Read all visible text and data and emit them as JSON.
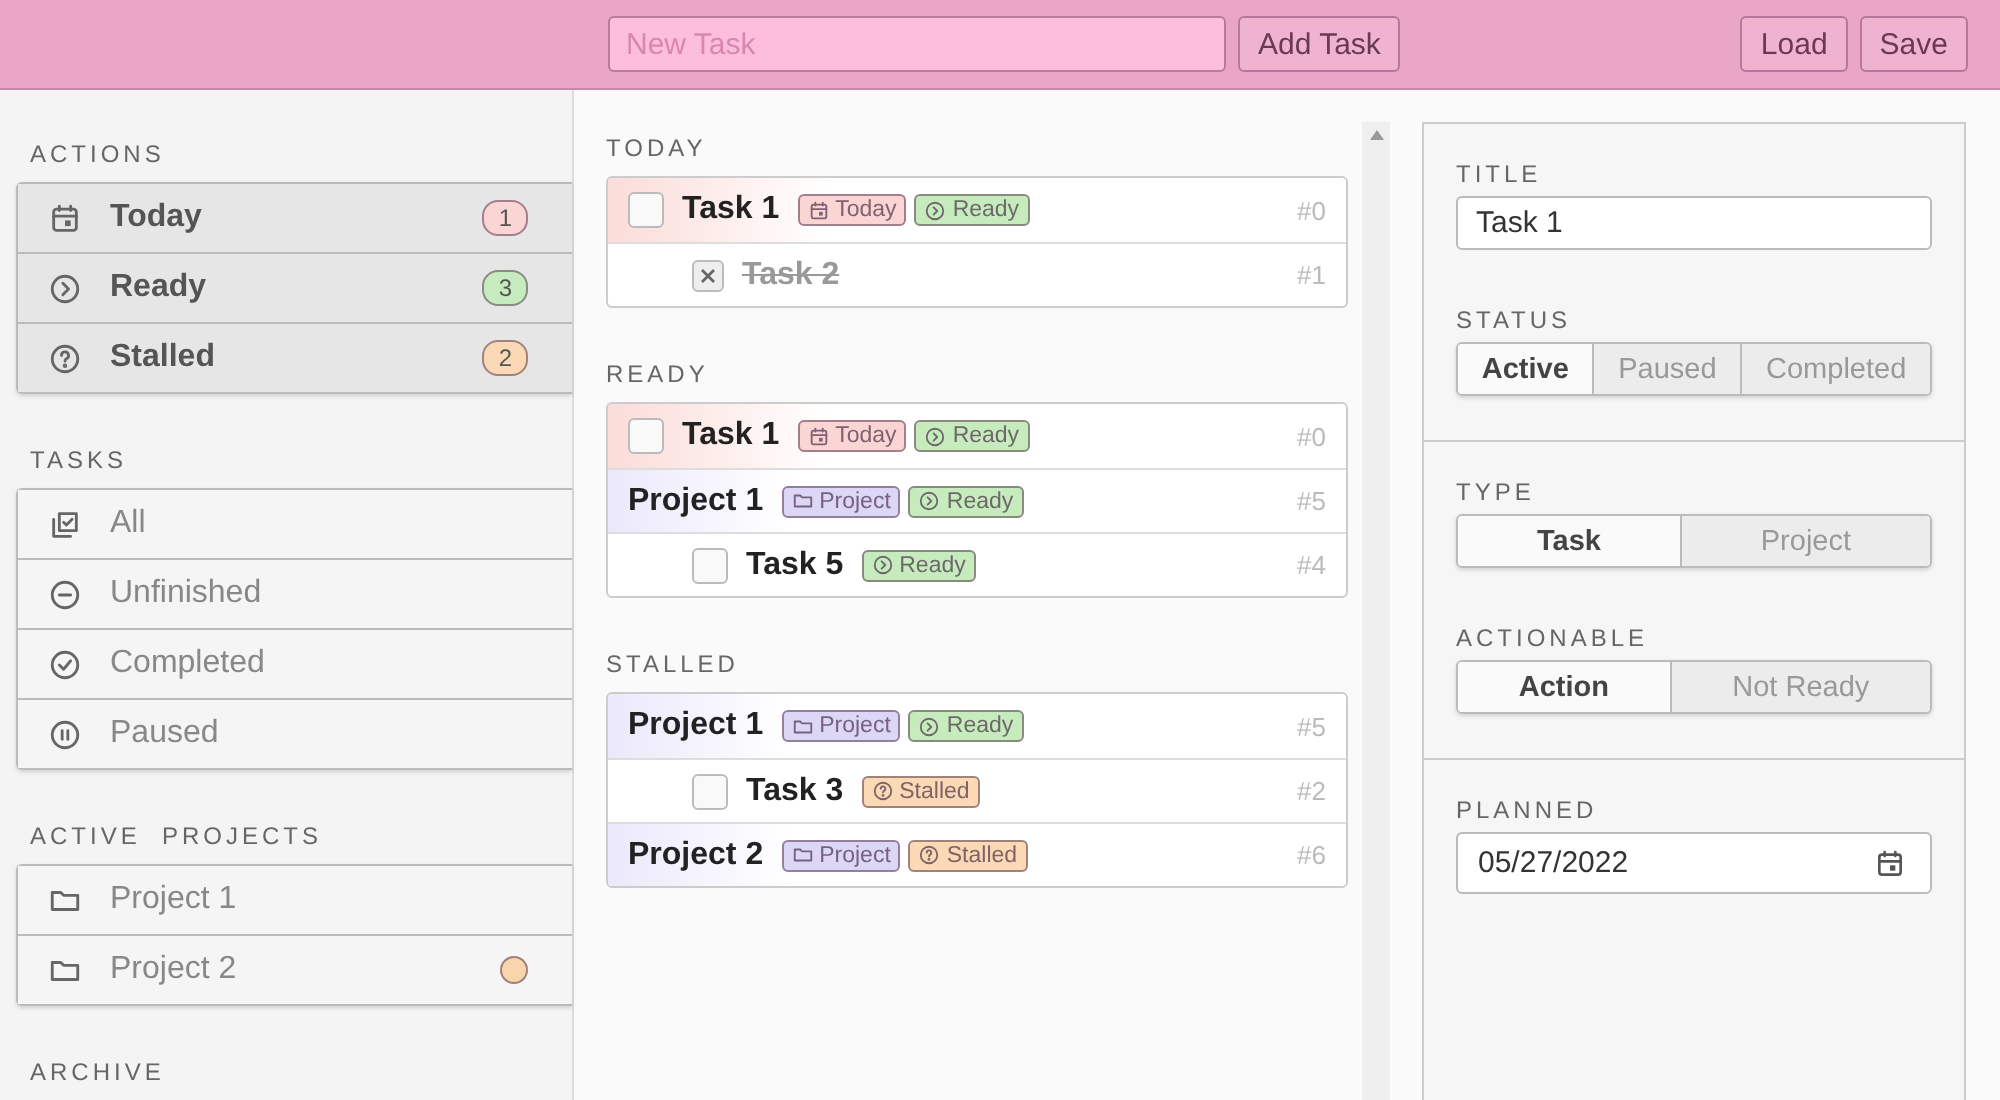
{
  "header": {
    "new_task": {
      "placeholder": "New Task"
    },
    "add_button": "Add Task",
    "load_button": "Load",
    "save_button": "Save"
  },
  "sidebar": {
    "sections": [
      {
        "title": "ACTIONS",
        "kind": "actions",
        "items": [
          {
            "label": "Today",
            "count": "1",
            "color": "#fbd4d4"
          },
          {
            "label": "Ready",
            "count": "3",
            "color": "#c6ecbd"
          },
          {
            "label": "Stalled",
            "count": "2",
            "color": "#fbd9b5"
          }
        ]
      },
      {
        "title": "TASKS",
        "kind": "list",
        "items": [
          {
            "label": "All"
          },
          {
            "label": "Unfinished"
          },
          {
            "label": "Completed"
          },
          {
            "label": "Paused"
          }
        ]
      },
      {
        "title": "ACTIVE  PROJECTS",
        "kind": "list",
        "items": [
          {
            "label": "Project 1"
          },
          {
            "label": "Project 2",
            "color": "#f9d5ad"
          }
        ]
      },
      {
        "title": "ARCHIVE"
      }
    ]
  },
  "groups": [
    {
      "title": "TODAY",
      "rows": [
        {
          "kind": "task",
          "title": "Task 1",
          "checked": false,
          "id": "#0",
          "tags": [
            {
              "kind": "today",
              "label": "Today",
              "color": "#fbd4d4"
            },
            {
              "kind": "ready",
              "label": "Ready",
              "color": "#c6ecbd"
            }
          ],
          "children": [
            {
              "kind": "task",
              "title": "Task 2",
              "checked": true,
              "id": "#1"
            }
          ]
        }
      ]
    },
    {
      "title": "READY",
      "rows": [
        {
          "kind": "task",
          "title": "Task 1",
          "checked": false,
          "id": "#0",
          "tags": [
            {
              "kind": "today",
              "label": "Today",
              "color": "#fbd4d4"
            },
            {
              "kind": "ready",
              "label": "Ready",
              "color": "#c6ecbd"
            }
          ]
        },
        {
          "kind": "project",
          "title": "Project 1",
          "id": "#5",
          "tags": [
            {
              "kind": "project",
              "label": "Project",
              "color": "#dcd6f7"
            },
            {
              "kind": "ready",
              "label": "Ready",
              "color": "#c6ecbd"
            }
          ],
          "children": [
            {
              "kind": "task",
              "title": "Task 5",
              "checked": false,
              "id": "#4",
              "tags": [
                {
                  "kind": "ready",
                  "label": "Ready",
                  "color": "#c6ecbd"
                }
              ]
            }
          ]
        }
      ]
    },
    {
      "title": "STALLED",
      "rows": [
        {
          "kind": "project",
          "title": "Project 1",
          "id": "#5",
          "tags": [
            {
              "kind": "project",
              "label": "Project",
              "color": "#dcd6f7"
            },
            {
              "kind": "ready",
              "label": "Ready",
              "color": "#c6ecbd"
            }
          ],
          "children": [
            {
              "kind": "task",
              "title": "Task 3",
              "checked": false,
              "id": "#2",
              "tags": [
                {
                  "kind": "stalled",
                  "label": "Stalled",
                  "color": "#fbd9b5"
                }
              ]
            }
          ]
        },
        {
          "kind": "project",
          "title": "Project 2",
          "id": "#6",
          "tags": [
            {
              "kind": "project",
              "label": "Project",
              "color": "#dcd6f7"
            },
            {
              "kind": "stalled",
              "label": "Stalled",
              "color": "#fbd9b5"
            }
          ]
        }
      ]
    }
  ],
  "detail": {
    "sections": [
      {
        "fields": [
          {
            "kind": "text",
            "label": "TITLE",
            "value": "Task 1"
          },
          {
            "kind": "segmented",
            "label": "STATUS",
            "options": [
              {
                "label": "Active",
                "selected": true
              },
              {
                "label": "Paused",
                "selected": false
              },
              {
                "label": "Completed",
                "selected": false
              }
            ]
          }
        ]
      },
      {
        "fields": [
          {
            "kind": "segmented",
            "label": "TYPE",
            "options": [
              {
                "label": "Task",
                "selected": true
              },
              {
                "label": "Project",
                "selected": false
              }
            ]
          },
          {
            "kind": "segmented",
            "label": "ACTIONABLE",
            "options": [
              {
                "label": "Action",
                "selected": true
              },
              {
                "label": "Not Ready",
                "selected": false
              }
            ]
          }
        ]
      },
      {
        "fields": [
          {
            "kind": "date",
            "label": "PLANNED",
            "value": "05/27/2022"
          }
        ]
      }
    ]
  }
}
